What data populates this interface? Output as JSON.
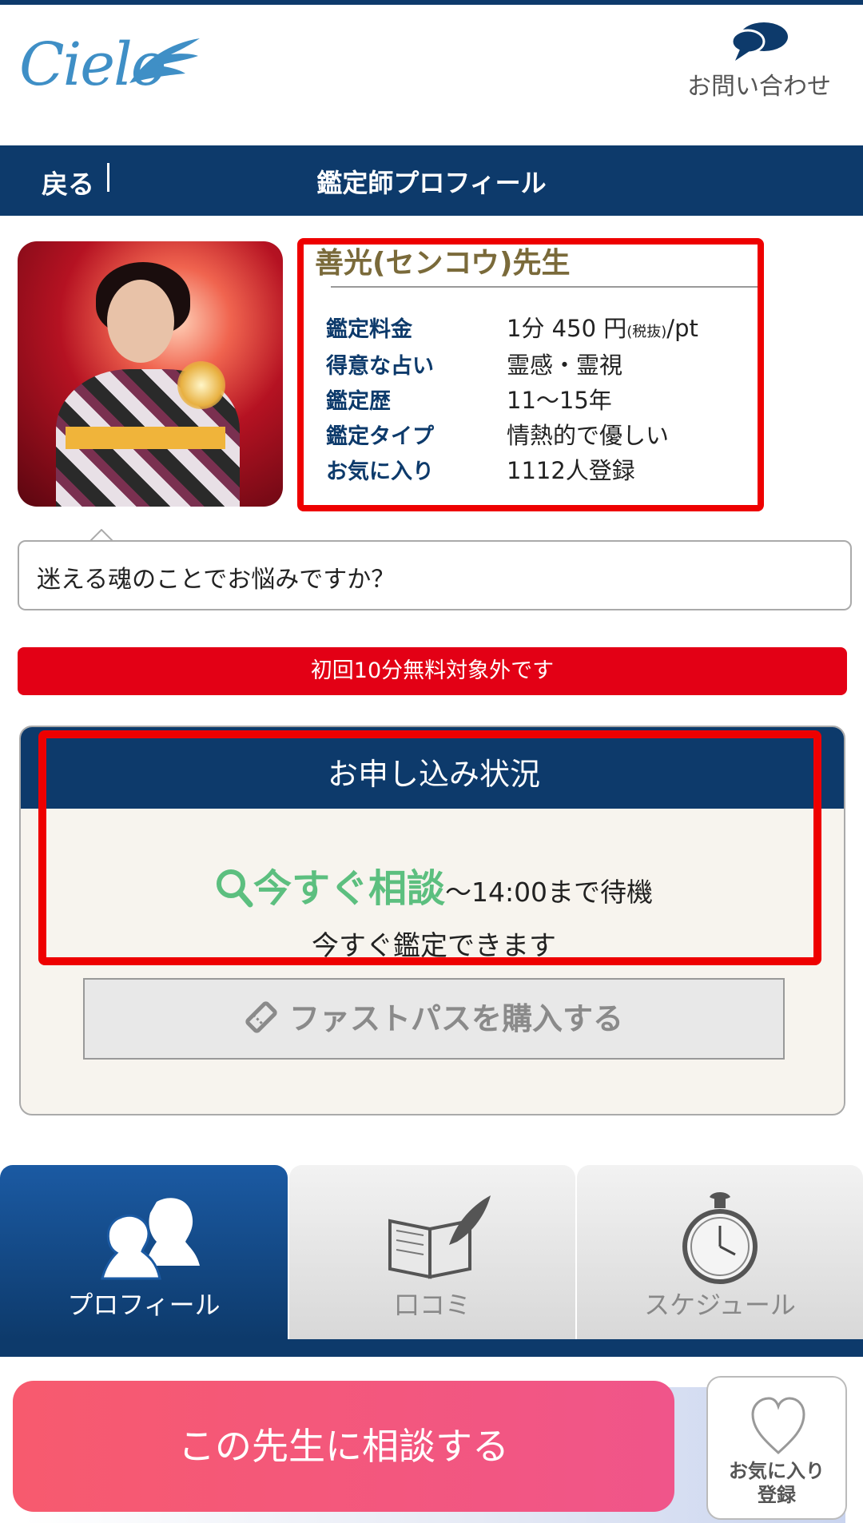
{
  "header": {
    "logo_text": "Cielo",
    "contact_label": "お問い合わせ"
  },
  "nav": {
    "back_label": "戻る",
    "title": "鑑定師プロフィール"
  },
  "profile": {
    "name": "善光(センコウ)先生",
    "fields": [
      {
        "key": "鑑定料金",
        "value": "1分 450 円",
        "tax": "(税抜)",
        "unit": "/pt"
      },
      {
        "key": "得意な占い",
        "value": "霊感・霊視"
      },
      {
        "key": "鑑定歴",
        "value": "11〜15年"
      },
      {
        "key": "鑑定タイプ",
        "value": "情熱的で優しい"
      },
      {
        "key": "お気に入り",
        "value": "1112人登録"
      }
    ],
    "message": "迷える魂のことでお悩みですか？"
  },
  "notice": {
    "free_trial": "初回10分無料対象外です"
  },
  "status": {
    "title": "お申し込み状況",
    "now_label": "今すぐ相談",
    "wait_text": "〜14:00まで待機",
    "sub_text": "今すぐ鑑定できます",
    "fastpass_label": "ファストパスを購入する"
  },
  "tabs": [
    {
      "label": "プロフィール",
      "icon": "profile-silhouette-icon",
      "active": true
    },
    {
      "label": "口コミ",
      "icon": "book-quill-icon",
      "active": false
    },
    {
      "label": "スケジュール",
      "icon": "pocket-watch-icon",
      "active": false
    }
  ],
  "cta": {
    "consult_label": "この先生に相談する",
    "favorite_label_1": "お気に入り",
    "favorite_label_2": "登録"
  },
  "colors": {
    "navy": "#0d3a6b",
    "red_highlight": "#ee0000",
    "notice_red": "#e30015",
    "now_green": "#5cbf7f",
    "cta_pink": "#f75a6e"
  }
}
